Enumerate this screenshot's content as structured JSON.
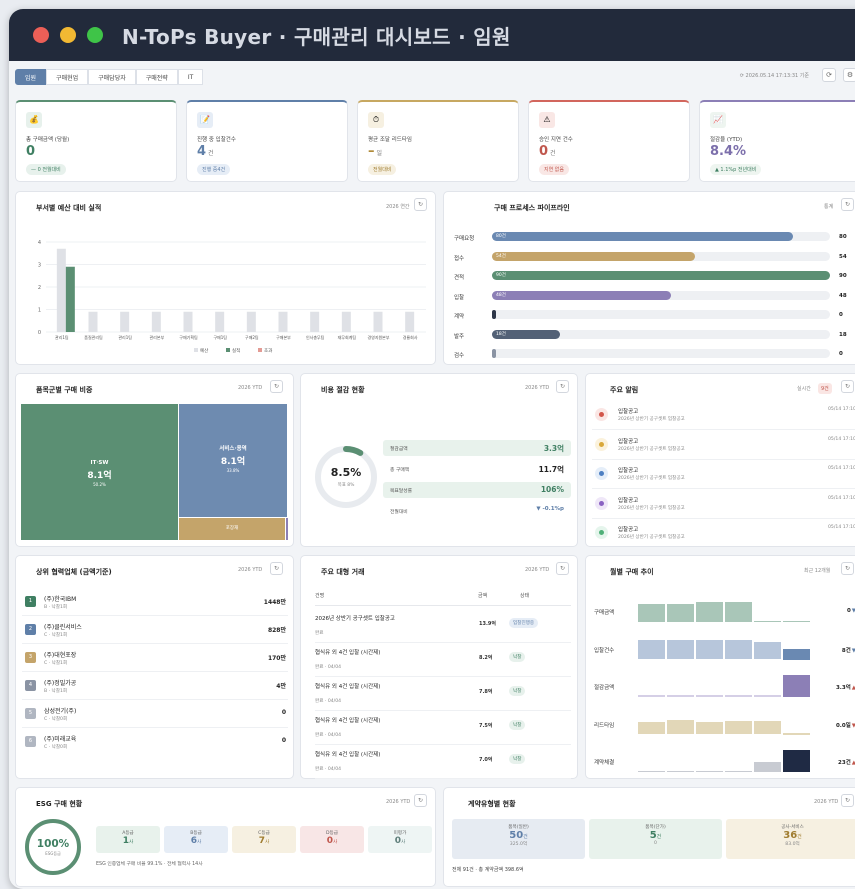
{
  "window": {
    "title": "N-ToPs Buyer · 구매관리 대시보드 · 임원",
    "dots": [
      "#ec5f57",
      "#f2b933",
      "#3fc448"
    ]
  },
  "tabs": [
    "임원",
    "구매현업",
    "구매담당자",
    "구매전략",
    "IT"
  ],
  "timestamp": "⟳ 2026.05.14 17:13:31 기준",
  "kpis": [
    {
      "icon": "💰",
      "label": "총 구매금액 (당월)",
      "value": "0",
      "unit": "",
      "chip": "— 0 전월대비",
      "accent": "#5b8f73",
      "val_color": "#3f7f62",
      "chip_bg": "#e7f1ec",
      "chip_color": "#3f7f62"
    },
    {
      "icon": "📝",
      "label": "진행 중 입찰건수",
      "value": "4",
      "unit": "건",
      "chip": "진행 중4건",
      "accent": "#5f7fa8",
      "val_color": "#5f7fa8",
      "chip_bg": "#e6edf6",
      "chip_color": "#5f7fa8"
    },
    {
      "icon": "⏱",
      "label": "평균 조달 리드타임",
      "value": "–",
      "unit": "일",
      "chip": "전월대비",
      "accent": "#c7a861",
      "val_color": "#b08a37",
      "chip_bg": "#f6f0e1",
      "chip_color": "#a07d30"
    },
    {
      "icon": "⚠",
      "label": "승인 지연 건수",
      "value": "0",
      "unit": "건",
      "chip": "지연 없음",
      "accent": "#d2665d",
      "val_color": "#c0574d",
      "chip_bg": "#f9e7e5",
      "chip_color": "#c0574d"
    },
    {
      "icon": "📈",
      "label": "절감율 (YTD)",
      "value": "8.4%",
      "unit": "",
      "chip": "▲ 1.1%p 전년대비",
      "accent": "#8c7fb6",
      "val_color": "#7c6fab",
      "chip_bg": "#eef5f0",
      "chip_color": "#3f7f62"
    }
  ],
  "budget": {
    "title": "부서별 예산 대비 실적",
    "meta": "2026 연간",
    "chart_data": {
      "type": "bar",
      "categories": [
        "관리1팀",
        "품질관리팀",
        "관리1팀",
        "관리본부",
        "구매기획팀",
        "구매1팀",
        "구매2팀",
        "구매본부",
        "인사총무팀",
        "재무회계팀",
        "경영지원본부",
        "경룡회사"
      ],
      "series": [
        {
          "name": "예산",
          "values": [
            3.7,
            0.9,
            0.9,
            0.9,
            0.9,
            0.9,
            0.9,
            0.9,
            0.9,
            0.9,
            0.9,
            0.9
          ]
        },
        {
          "name": "실적",
          "values": [
            2.9,
            0,
            0,
            0,
            0,
            0,
            0,
            0,
            0,
            0,
            0,
            0
          ]
        },
        {
          "name": "초과",
          "values": [
            0,
            0,
            0,
            0,
            0,
            0,
            0,
            0,
            0,
            0,
            0,
            0
          ]
        }
      ],
      "yticks": [
        "0",
        "1",
        "2",
        "3",
        "4"
      ],
      "ylim": [
        0,
        4
      ]
    }
  },
  "pipeline": {
    "title": "구매 프로세스 파이프라인",
    "meta": "통계",
    "rows": [
      {
        "label": "구매요청",
        "badge": "80건",
        "value": "80",
        "pct": 0.89,
        "color": "#6a89b2"
      },
      {
        "label": "접수",
        "badge": "54건",
        "value": "54",
        "pct": 0.6,
        "color": "#c4a46a"
      },
      {
        "label": "견적",
        "badge": "90건",
        "value": "90",
        "pct": 1.0,
        "color": "#5b8f73"
      },
      {
        "label": "입찰",
        "badge": "48건",
        "value": "48",
        "pct": 0.53,
        "color": "#8c7fb6"
      },
      {
        "label": "계약",
        "badge": "",
        "value": "0",
        "pct": 0.01,
        "color": "#2d3648"
      },
      {
        "label": "발주",
        "badge": "18건",
        "value": "18",
        "pct": 0.2,
        "color": "#536176"
      },
      {
        "label": "검수",
        "badge": "",
        "value": "0",
        "pct": 0.01,
        "color": "#8a93a3"
      }
    ]
  },
  "treemap": {
    "title": "품목군별 구매 비중",
    "meta": "2026 YTD",
    "blocks": [
      {
        "name": "IT·SW",
        "amount": "8.1억",
        "pct": "50.2%"
      },
      {
        "name": "서비스·용역",
        "amount": "8.1억",
        "pct": "33.8%"
      },
      {
        "name": "포장재",
        "amount": "",
        "pct": ""
      }
    ]
  },
  "savings": {
    "title": "비용 절감 현황",
    "meta": "2026 YTD",
    "donut_value": "8.5%",
    "donut_sub": "목표 8%",
    "rows": [
      {
        "label": "절감금액",
        "value": "3.3억",
        "bg": "#e8f2ec",
        "color": "#3f7f62"
      },
      {
        "label": "총 구매액",
        "value": "11.7억",
        "bg": "#fff",
        "color": "#222"
      },
      {
        "label": "목표달성률",
        "value": "106%",
        "bg": "#e8f2ec",
        "color": "#3f7f62"
      },
      {
        "label": "전월대비",
        "value": "▼ -0.1%p",
        "bg": "#fff",
        "color": "#5f7fa8"
      }
    ]
  },
  "alerts": {
    "title": "주요 알림",
    "meta": "실시간",
    "badge": "9건",
    "items": [
      {
        "title": "입찰공고",
        "sub": "2026년 상반기 공구셋트 입찰공고",
        "time": "05/14 17:10",
        "dot": "#d2554a",
        "bg": "#fae6e4"
      },
      {
        "title": "입찰공고",
        "sub": "2026년 상반기 공구셋트 입찰공고",
        "time": "05/14 17:10",
        "dot": "#d9a83a",
        "bg": "#fbf2dc"
      },
      {
        "title": "입찰공고",
        "sub": "2026년 상반기 공구셋트 입찰공고",
        "time": "05/14 17:10",
        "dot": "#4d7fc2",
        "bg": "#e5eef9"
      },
      {
        "title": "입찰공고",
        "sub": "2026년 상반기 공구셋트 입찰공고",
        "time": "05/14 17:10",
        "dot": "#8a62c2",
        "bg": "#efe7f8"
      },
      {
        "title": "입찰공고",
        "sub": "2026년 상반기 공구셋트 입찰공고",
        "time": "05/14 17:10",
        "dot": "#4fb078",
        "bg": "#e5f5ec"
      }
    ]
  },
  "suppliers": {
    "title": "상위 협력업체 (금액기준)",
    "meta": "2026 YTD",
    "items": [
      {
        "rank": "1",
        "name": "(주)한국IBM",
        "sub": "B · 낙찰1회",
        "amount": "1448만",
        "color": "#3f7f62"
      },
      {
        "rank": "2",
        "name": "(주)클린서비스",
        "sub": "C · 낙찰1회",
        "amount": "828만",
        "color": "#5f7fa8"
      },
      {
        "rank": "3",
        "name": "(주)대현포장",
        "sub": "C · 낙찰1회",
        "amount": "170만",
        "color": "#c4a46a"
      },
      {
        "rank": "4",
        "name": "(주)정밀가공",
        "sub": "B · 낙찰1회",
        "amount": "4만",
        "color": "#8a93a3"
      },
      {
        "rank": "5",
        "name": "삼성전기(주)",
        "sub": "C · 낙찰0회",
        "amount": "0",
        "color": "#b0b6c1"
      },
      {
        "rank": "6",
        "name": "(주)미래교육",
        "sub": "C · 낙찰0회",
        "amount": "0",
        "color": "#b0b6c1"
      }
    ]
  },
  "deals": {
    "title": "주요 대형 거래",
    "meta": "2026 YTD",
    "headers": [
      "건명",
      "금액",
      "상태"
    ],
    "rows": [
      {
        "name": "2026년 상반기 공구셋트 입찰공고",
        "sub": "완료",
        "amount": "13.9억",
        "status": "입찰진행중",
        "sbg": "#e6edf6",
        "scolor": "#5f7fa8"
      },
      {
        "name": "협식유 외 4건 입찰 (시간제)",
        "sub": "완료 · 04/04",
        "amount": "8.2억",
        "status": "낙찰",
        "sbg": "#e7f1ec",
        "scolor": "#3f7f62"
      },
      {
        "name": "협식유 외 4건 입찰 (시간제)",
        "sub": "완료 · 04/04",
        "amount": "7.8억",
        "status": "낙찰",
        "sbg": "#e7f1ec",
        "scolor": "#3f7f62"
      },
      {
        "name": "협식유 외 4건 입찰 (시간제)",
        "sub": "완료 · 04/04",
        "amount": "7.5억",
        "status": "낙찰",
        "sbg": "#e7f1ec",
        "scolor": "#3f7f62"
      },
      {
        "name": "협식유 외 4건 입찰 (시간제)",
        "sub": "완료 · 04/04",
        "amount": "7.0억",
        "status": "낙찰",
        "sbg": "#e7f1ec",
        "scolor": "#3f7f62"
      }
    ]
  },
  "monthly": {
    "title": "월별 구매 추이",
    "meta": "최근 12개월",
    "rows": [
      {
        "label": "구매금액",
        "value": "0",
        "arrow": "▼",
        "arrow_color": "#5f7fa8",
        "color": "#a9c6b8",
        "last": "#a9c6b8",
        "heights": [
          0.8,
          0.8,
          0.9,
          0.9,
          0.05,
          0.05
        ]
      },
      {
        "label": "입찰건수",
        "value": "8건",
        "arrow": "▼",
        "arrow_color": "#5f7fa8",
        "color": "#b7c6db",
        "last": "#6a89b2",
        "heights": [
          0.9,
          0.9,
          0.9,
          0.9,
          0.8,
          0.5
        ]
      },
      {
        "label": "절감금액",
        "value": "3.3억",
        "arrow": "▲",
        "arrow_color": "#c0574d",
        "color": "#d5cfe6",
        "last": "#8c7fb6",
        "heights": [
          0.08,
          0.08,
          0.08,
          0.08,
          0.08,
          1.0
        ]
      },
      {
        "label": "리드타임",
        "value": "0.0일",
        "arrow": "▼",
        "arrow_color": "#c0574d",
        "color": "#e2d7b8",
        "last": "#e2d7b8",
        "heights": [
          0.55,
          0.65,
          0.55,
          0.6,
          0.6,
          0.05
        ]
      },
      {
        "label": "계약체결",
        "value": "23건",
        "arrow": "▲",
        "arrow_color": "#c0574d",
        "color": "#c8cbd2",
        "last": "#1f2a44",
        "heights": [
          0.05,
          0.05,
          0.05,
          0.05,
          0.45,
          1.0
        ]
      }
    ]
  },
  "esg": {
    "title": "ESG 구매 현황",
    "meta": "2026 YTD",
    "ring_value": "100%",
    "ring_sub": "ESG등급",
    "grades": [
      {
        "label": "A등급",
        "value": "1",
        "unit": "사",
        "bg": "#e8f2ec",
        "color": "#3f7f62"
      },
      {
        "label": "B등급",
        "value": "6",
        "unit": "사",
        "bg": "#e6edf6",
        "color": "#5f7fa8"
      },
      {
        "label": "C등급",
        "value": "7",
        "unit": "사",
        "bg": "#f6f0e1",
        "color": "#a07d30"
      },
      {
        "label": "D등급",
        "value": "0",
        "unit": "사",
        "bg": "#f8e6e6",
        "color": "#c0574d"
      },
      {
        "label": "미평가",
        "value": "0",
        "unit": "사",
        "bg": "#eef5f4",
        "color": "#5e7e7a"
      }
    ],
    "note": "ESG 인증업체 구매 비율 99.1% · 전체 협력사 14사"
  },
  "contracts": {
    "title": "계약유형별 현황",
    "meta": "2026 YTD",
    "items": [
      {
        "label": "품목(일반)",
        "value": "50",
        "unit": "건",
        "sub": "325.0억",
        "bg": "#e6ebf2",
        "color": "#5f7fa8"
      },
      {
        "label": "품목(단가)",
        "value": "5",
        "unit": "건",
        "sub": "0",
        "bg": "#e8f2ec",
        "color": "#3f7f62"
      },
      {
        "label": "공사·서비스",
        "value": "36",
        "unit": "건",
        "sub": "83.0억",
        "bg": "#f6f0e1",
        "color": "#a07d30"
      }
    ],
    "summary": "전체 91건 · 총 계약금액 398.6억"
  }
}
